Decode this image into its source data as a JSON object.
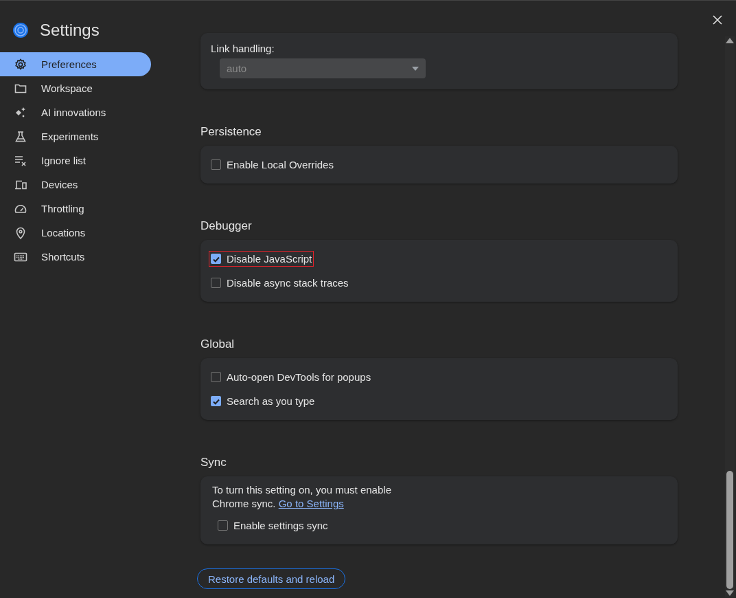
{
  "title": "Settings",
  "sidebar": {
    "items": [
      {
        "label": "Preferences",
        "selected": true
      },
      {
        "label": "Workspace",
        "selected": false
      },
      {
        "label": "AI innovations",
        "selected": false
      },
      {
        "label": "Experiments",
        "selected": false
      },
      {
        "label": "Ignore list",
        "selected": false
      },
      {
        "label": "Devices",
        "selected": false
      },
      {
        "label": "Throttling",
        "selected": false
      },
      {
        "label": "Locations",
        "selected": false
      },
      {
        "label": "Shortcuts",
        "selected": false
      }
    ]
  },
  "sections": [
    {
      "items": [
        {
          "kind": "select",
          "label": "Link handling:",
          "value": "auto",
          "disabled": true
        }
      ]
    },
    {
      "title": "Persistence",
      "items": [
        {
          "kind": "checkbox",
          "label": "Enable Local Overrides",
          "checked": false,
          "highlighted": false,
          "indented": false
        }
      ]
    },
    {
      "title": "Debugger",
      "items": [
        {
          "kind": "checkbox",
          "label": "Disable JavaScript",
          "checked": true,
          "highlighted": true,
          "indented": false
        },
        {
          "kind": "checkbox",
          "label": "Disable async stack traces",
          "checked": false,
          "highlighted": false,
          "indented": false
        }
      ]
    },
    {
      "title": "Global",
      "items": [
        {
          "kind": "checkbox",
          "label": "Auto-open DevTools for popups",
          "checked": false,
          "highlighted": false,
          "indented": false
        },
        {
          "kind": "checkbox",
          "label": "Search as you type",
          "checked": true,
          "highlighted": false,
          "indented": false
        }
      ]
    },
    {
      "title": "Sync",
      "items": [
        {
          "kind": "note",
          "text": "To turn this setting on, you must enable Chrome sync.",
          "link": "Go to Settings"
        },
        {
          "kind": "checkbox",
          "label": "Enable settings sync",
          "checked": false,
          "highlighted": false,
          "indented": true
        }
      ]
    }
  ],
  "restore_button": "Restore defaults and reload"
}
